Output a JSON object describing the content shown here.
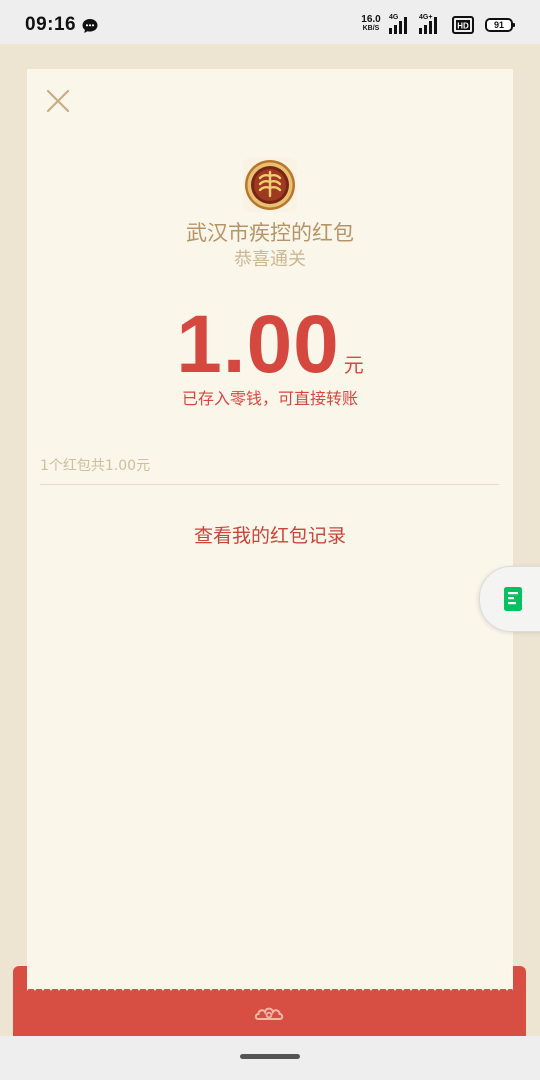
{
  "status_bar": {
    "time": "09:16",
    "net_speed": "16.0",
    "net_speed_unit": "KB/S",
    "signal_1_label": "4G",
    "signal_2_label": "4G+",
    "hd_label": "HD",
    "battery": "91",
    "battery_level": 0.91
  },
  "red_packet": {
    "sender_name": "武汉市疾控的红包",
    "greeting": "恭喜通关",
    "amount": "1.00",
    "currency_unit": "元",
    "deposit_note": "已存入零钱，可直接转账",
    "summary": "1个红包共1.00元",
    "records_link": "查看我的红包记录"
  },
  "colors": {
    "accent_red": "#d54840",
    "gold": "#b59567",
    "card_bg": "#faf6ea",
    "page_bg": "#ede5d2",
    "floating_icon": "#07c160"
  },
  "icons": {
    "close": "close-icon",
    "chat_notification": "chat-bubble-icon",
    "floating": "document-icon",
    "packet_emblem": "cloud-emblem-icon"
  }
}
